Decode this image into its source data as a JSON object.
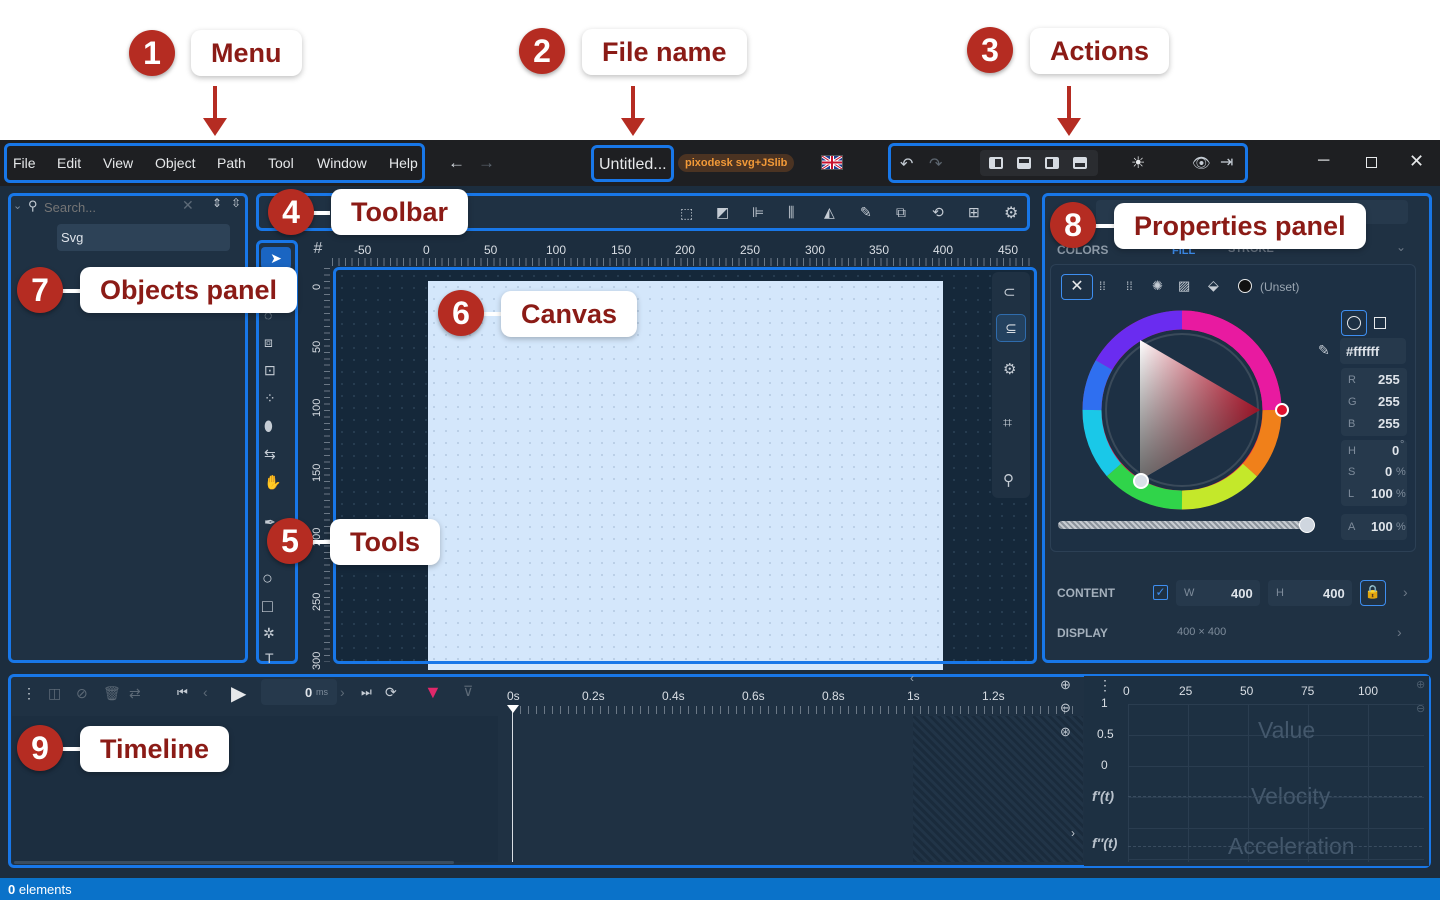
{
  "callouts": [
    {
      "num": "1",
      "label": "Menu"
    },
    {
      "num": "2",
      "label": "File name"
    },
    {
      "num": "3",
      "label": "Actions"
    },
    {
      "num": "4",
      "label": "Toolbar"
    },
    {
      "num": "5",
      "label": "Tools"
    },
    {
      "num": "6",
      "label": "Canvas"
    },
    {
      "num": "7",
      "label": "Objects panel"
    },
    {
      "num": "8",
      "label": "Properties panel"
    },
    {
      "num": "9",
      "label": "Timeline"
    }
  ],
  "menu": [
    "File",
    "Edit",
    "View",
    "Object",
    "Path",
    "Tool",
    "Window",
    "Help"
  ],
  "file": {
    "name": "Untitled...",
    "badge": "pixodesk svg+JSlib"
  },
  "objects": {
    "search_placeholder": "Search...",
    "root": "Svg"
  },
  "ruler": {
    "h": [
      "-50",
      "0",
      "50",
      "100",
      "150",
      "200",
      "250",
      "300",
      "350",
      "400",
      "450"
    ],
    "v": [
      "0",
      "50",
      "100",
      "150",
      "200",
      "250",
      "300"
    ]
  },
  "properties": {
    "section_colors": "COLORS",
    "tab_fill": "FILL",
    "tab_stroke": "STROKE",
    "unset": "(Unset)",
    "hex": "#ffffff",
    "r_label": "R",
    "r": "255",
    "g_label": "G",
    "g": "255",
    "b_label": "B",
    "b": "255",
    "h_label": "H",
    "h": "0",
    "s_label": "S",
    "s": "0",
    "l_label": "L",
    "l": "100",
    "a_label": "A",
    "a": "100",
    "content_label": "CONTENT",
    "w_label": "W",
    "w": "400",
    "h2_label": "H",
    "h2": "400",
    "display_label": "DISPLAY",
    "display_value": "400 × 400"
  },
  "timeline": {
    "time": "0",
    "time_unit": "ms",
    "ticks": [
      "0s",
      "0.2s",
      "0.4s",
      "0.6s",
      "0.8s",
      "1s",
      "1.2s"
    ],
    "graph_x": [
      "0",
      "25",
      "50",
      "75",
      "100"
    ],
    "graph_y": [
      "1",
      "0.5",
      "0"
    ],
    "f1": "f′(t)",
    "f2": "f′′(t)",
    "value": "Value",
    "velocity": "Velocity",
    "acceleration": "Acceleration"
  },
  "status": {
    "count": "0",
    "suffix": " elements"
  },
  "colors": {
    "accent": "#1877e8",
    "callout": "#b52c22",
    "canvas": "#d4e7fb",
    "status": "#0a72c9"
  }
}
